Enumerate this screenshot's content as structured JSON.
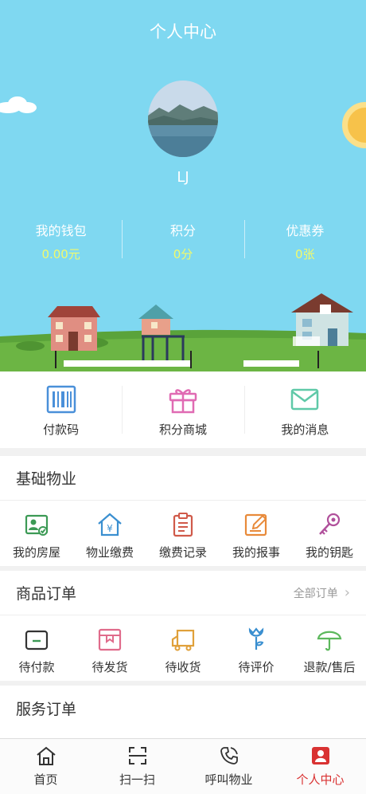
{
  "header": {
    "title": "个人中心"
  },
  "profile": {
    "username": "LJ"
  },
  "stats": [
    {
      "label": "我的钱包",
      "value": "0.00元"
    },
    {
      "label": "积分",
      "value": "0分"
    },
    {
      "label": "优惠券",
      "value": "0张"
    }
  ],
  "quick_actions": [
    {
      "label": "付款码",
      "icon": "barcode-icon"
    },
    {
      "label": "积分商城",
      "icon": "gift-icon"
    },
    {
      "label": "我的消息",
      "icon": "mail-icon"
    }
  ],
  "property": {
    "title": "基础物业",
    "items": [
      {
        "label": "我的房屋",
        "icon": "house-id-icon"
      },
      {
        "label": "物业缴费",
        "icon": "house-yen-icon"
      },
      {
        "label": "缴费记录",
        "icon": "clipboard-icon"
      },
      {
        "label": "我的报事",
        "icon": "edit-icon"
      },
      {
        "label": "我的钥匙",
        "icon": "key-icon"
      }
    ]
  },
  "goods_orders": {
    "title": "商品订单",
    "more": "全部订单",
    "items": [
      {
        "label": "待付款",
        "icon": "wallet-icon"
      },
      {
        "label": "待发货",
        "icon": "package-icon"
      },
      {
        "label": "待收货",
        "icon": "truck-icon"
      },
      {
        "label": "待评价",
        "icon": "flower-icon"
      },
      {
        "label": "退款/售后",
        "icon": "umbrella-icon"
      }
    ]
  },
  "service_orders": {
    "title": "服务订单"
  },
  "tabbar": [
    {
      "label": "首页",
      "icon": "home-icon"
    },
    {
      "label": "扫一扫",
      "icon": "scan-icon"
    },
    {
      "label": "呼叫物业",
      "icon": "phone-icon"
    },
    {
      "label": "个人中心",
      "icon": "profile-icon",
      "active": true
    }
  ],
  "colors": {
    "sky": "#7fd8f1",
    "highlight": "#f1fa6c",
    "active_tab": "#d93232"
  }
}
